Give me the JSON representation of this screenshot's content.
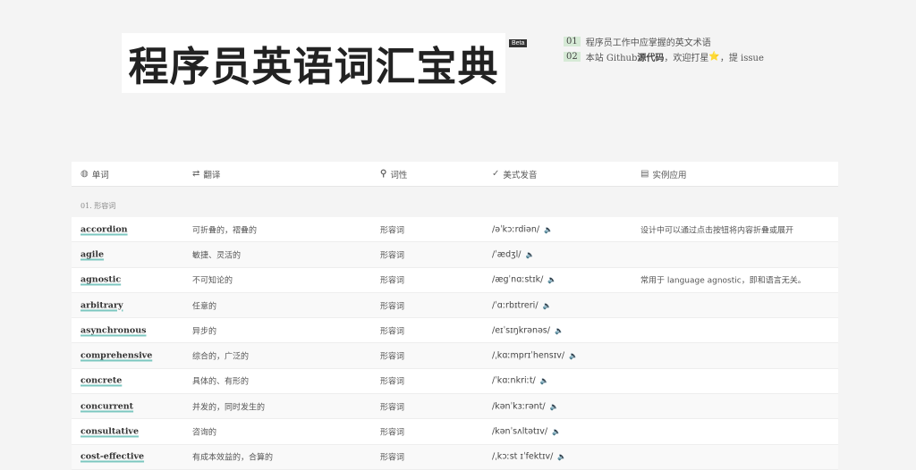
{
  "site": {
    "title": "程序员英语词汇宝典",
    "badge": "Beta"
  },
  "notes": [
    {
      "num": "01",
      "text": "程序员工作中应掌握的英文术语"
    },
    {
      "num": "02",
      "pre": "本站 Github ",
      "link": "源代码",
      "mid": "，欢迎打星",
      "star": "⭐",
      "post": "，提 issue"
    }
  ],
  "table": {
    "headers": [
      {
        "icon": "globe-icon",
        "glyph": "◍",
        "label": "单词"
      },
      {
        "icon": "swap-icon",
        "glyph": "⇄",
        "label": "翻译"
      },
      {
        "icon": "search-icon",
        "glyph": "🔍",
        "label": "词性"
      },
      {
        "icon": "check-circle-icon",
        "glyph": "✓",
        "label": "美式发音"
      },
      {
        "icon": "book-icon",
        "glyph": "▤",
        "label": "实例应用"
      }
    ],
    "group": "01. 形容词",
    "rows": [
      {
        "word": "accordion",
        "translation": "可折叠的，褶叠的",
        "pos": "形容词",
        "pron": "/əˈkɔːrdiən/",
        "example": "设计中可以通过点击按钮将内容折叠或展开"
      },
      {
        "word": "agile",
        "translation": "敏捷、灵活的",
        "pos": "形容词",
        "pron": "/ˈædʒl/",
        "example": ""
      },
      {
        "word": "agnostic",
        "translation": "不可知论的",
        "pos": "形容词",
        "pron": "/ægˈnɑːstɪk/",
        "example": "常用于 language agnostic，即和语言无关。"
      },
      {
        "word": "arbitrary",
        "translation": "任意的",
        "pos": "形容词",
        "pron": "/ˈɑːrbɪtreri/",
        "example": ""
      },
      {
        "word": "asynchronous",
        "translation": "异步的",
        "pos": "形容词",
        "pron": "/eɪˈsɪŋkrənəs/",
        "example": ""
      },
      {
        "word": "comprehensive",
        "translation": "综合的，广泛的",
        "pos": "形容词",
        "pron": "/ˌkɑːmprɪˈhensɪv/",
        "example": ""
      },
      {
        "word": "concrete",
        "translation": "具体的、有形的",
        "pos": "形容词",
        "pron": "/ˈkɑːnkriːt/",
        "example": ""
      },
      {
        "word": "concurrent",
        "translation": "并发的，同时发生的",
        "pos": "形容词",
        "pron": "/kənˈkɜːrənt/",
        "example": ""
      },
      {
        "word": "consultative",
        "translation": "咨询的",
        "pos": "形容词",
        "pron": "/kənˈsʌltətɪv/",
        "example": ""
      },
      {
        "word": "cost-effective",
        "translation": "有成本效益的，合算的",
        "pos": "形容词",
        "pron": "/ˌkɔːst ɪˈfektɪv/",
        "example": ""
      }
    ],
    "speaker_icon": "🔈"
  }
}
